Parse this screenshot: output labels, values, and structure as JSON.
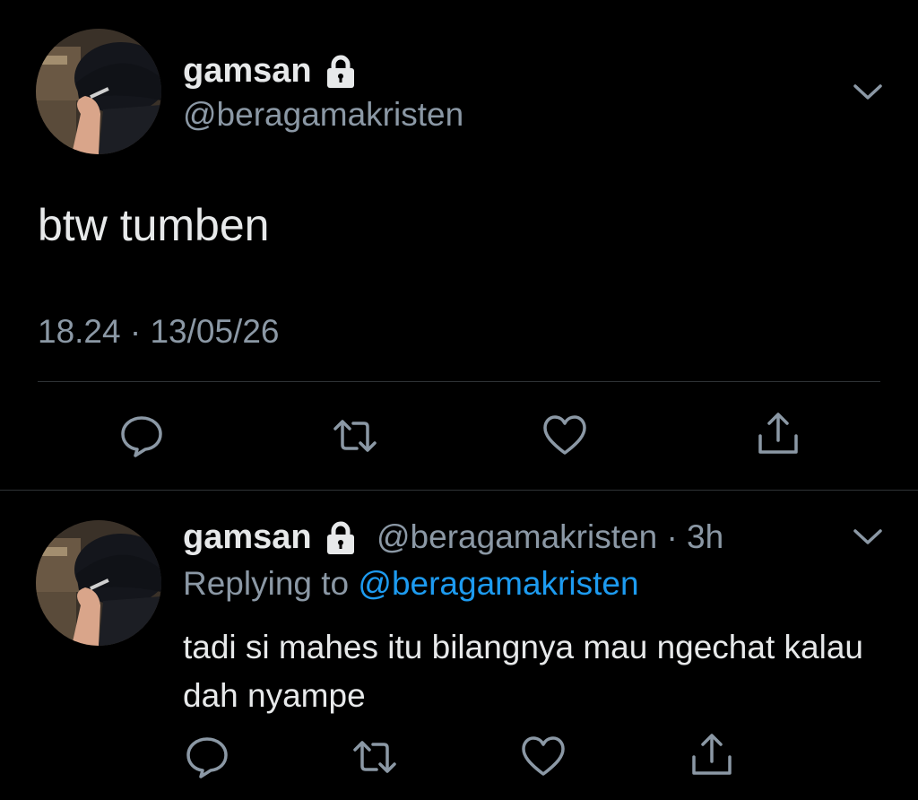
{
  "main_tweet": {
    "display_name": "gamsan",
    "handle": "@beragamakristen",
    "text": "btw tumben",
    "timestamp": "18.24 · 13/05/26",
    "protected_icon": "lock-icon",
    "menu_icon": "chevron-down-icon",
    "actions": [
      "reply-icon",
      "retweet-icon",
      "like-icon",
      "share-icon"
    ]
  },
  "reply_tweet": {
    "display_name": "gamsan",
    "handle": "@beragamakristen",
    "separator": "·",
    "time_ago": "3h",
    "replying_label": "Replying to",
    "replying_to": "@beragamakristen",
    "text": "tadi si mahes itu bilangnya mau ngechat kalau dah nyampe",
    "protected_icon": "lock-icon",
    "menu_icon": "chevron-down-icon",
    "actions": [
      "reply-icon",
      "retweet-icon",
      "like-icon",
      "share-icon"
    ]
  },
  "colors": {
    "background": "#000000",
    "primary_text": "#e7e9ea",
    "secondary_text": "#8b98a5",
    "link": "#1d9bf0",
    "divider": "#2f3336"
  }
}
